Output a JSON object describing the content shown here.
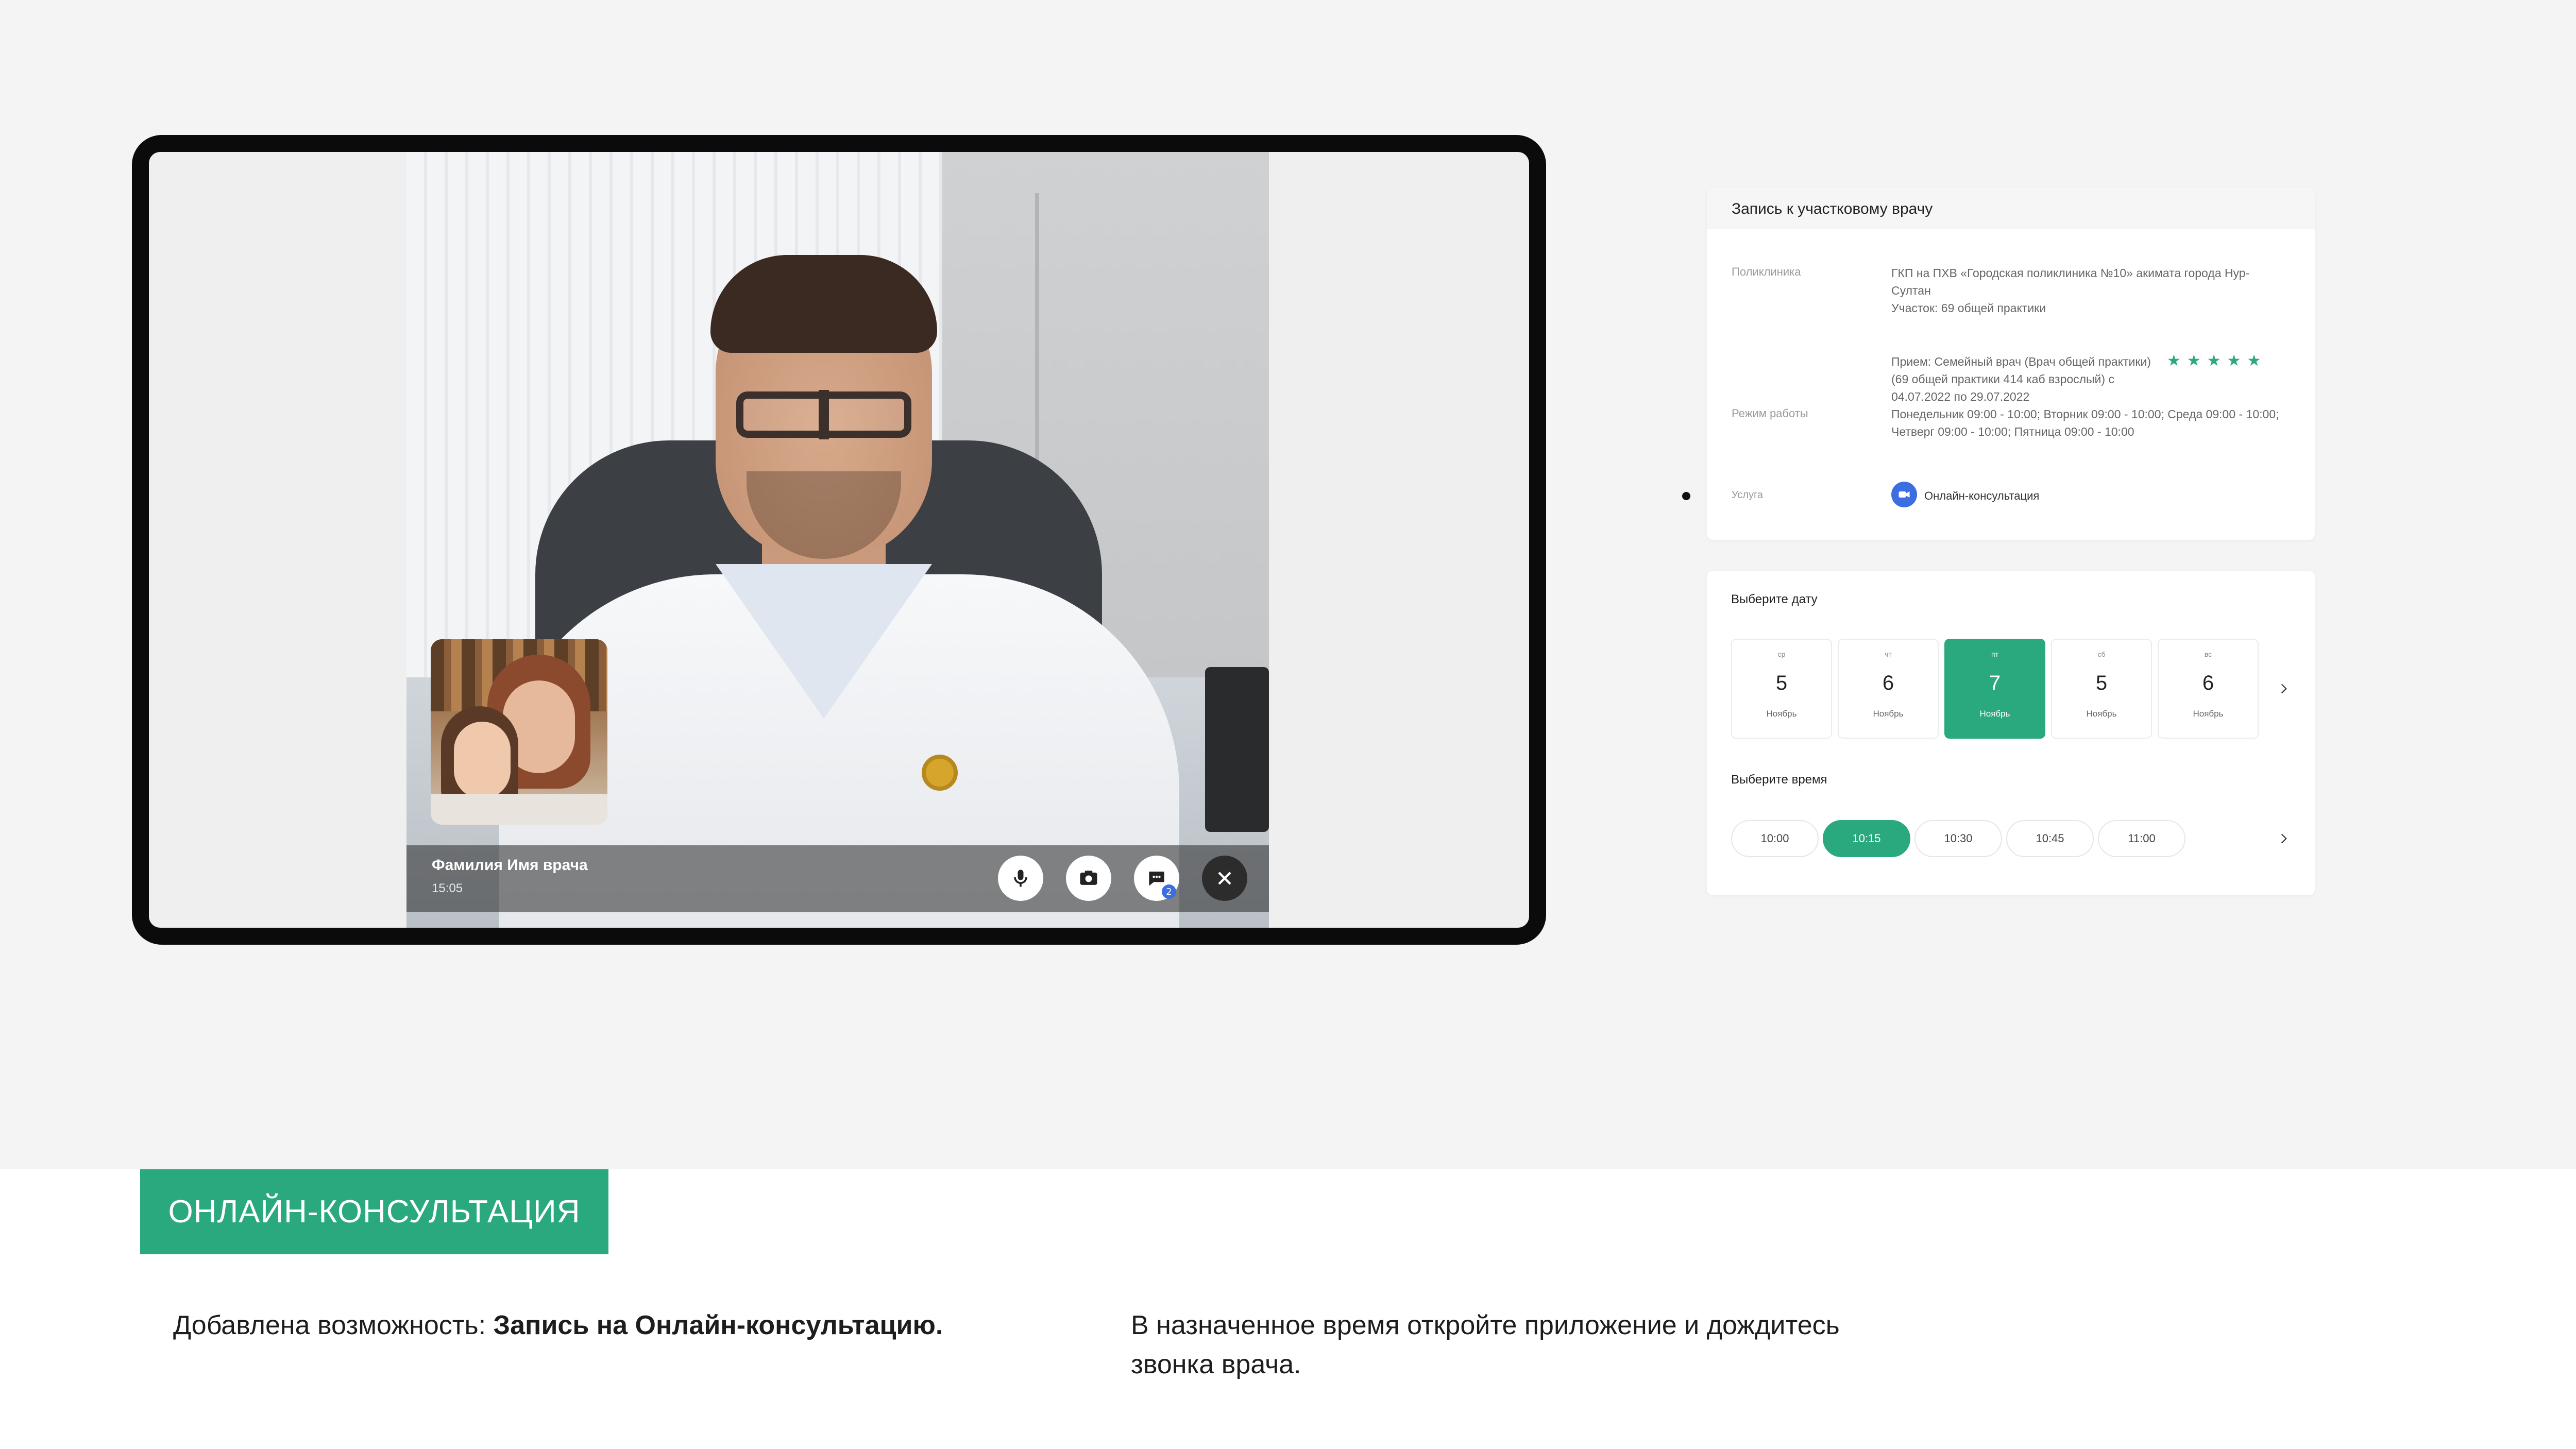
{
  "call": {
    "caller_name": "Фамилия Имя врача",
    "call_time": "15:05",
    "controls": {
      "mic_icon": "microphone-icon",
      "camera_icon": "camera-switch-icon",
      "chat_icon": "chat-icon",
      "chat_badge": "2",
      "end_icon": "close-icon"
    }
  },
  "appointment": {
    "title": "Запись к участковому врачу",
    "clinic_label": "Поликлиника",
    "clinic_value": "ГКП на ПХВ «Городская поликлиника №10» акимата города Нур-Султан",
    "district_value": "Участок: 69 общей практики",
    "reception_value": "Прием: Семейный врач (Врач общей практики) (69 общей практики 414 каб взрослый) с 04.07.2022 по 29.07.2022",
    "rating_stars": "★★★★★",
    "schedule_label": "Режим работы",
    "schedule_value": "Понедельник 09:00 - 10:00; Вторник 09:00 - 10:00; Среда 09:00 - 10:00; Четверг 09:00 - 10:00; Пятница 09:00 - 10:00",
    "service_label": "Услуга",
    "service_value": "Онлайн-консультация",
    "service_icon": "video-camera-icon"
  },
  "date_picker": {
    "title": "Выберите дату",
    "dates": [
      {
        "dow": "ср",
        "num": "5",
        "month": "Ноябрь",
        "active": false
      },
      {
        "dow": "чт",
        "num": "6",
        "month": "Ноябрь",
        "active": false
      },
      {
        "dow": "пт",
        "num": "7",
        "month": "Ноябрь",
        "active": true
      },
      {
        "dow": "сб",
        "num": "5",
        "month": "Ноябрь",
        "active": false
      },
      {
        "dow": "вс",
        "num": "6",
        "month": "Ноябрь",
        "active": false
      }
    ],
    "next_icon": "chevron-right-icon"
  },
  "time_picker": {
    "title": "Выберите время",
    "times": [
      {
        "label": "10:00",
        "active": false
      },
      {
        "label": "10:15",
        "active": true
      },
      {
        "label": "10:30",
        "active": false
      },
      {
        "label": "10:45",
        "active": false
      },
      {
        "label": "11:00",
        "active": false
      }
    ],
    "next_icon": "chevron-right-icon"
  },
  "colors": {
    "accent": "#2aa97e",
    "service_icon_bg": "#3b6ee0"
  },
  "bottom": {
    "banner": "ОНЛАЙН-КОНСУЛЬТАЦИЯ",
    "caption_left_prefix": "Добавлена возможность: ",
    "caption_left_bold": "Запись на Онлайн-консультацию.",
    "caption_right_line1": "В назначенное время откройте приложение и дождитесь",
    "caption_right_line2": "звонка врача."
  }
}
